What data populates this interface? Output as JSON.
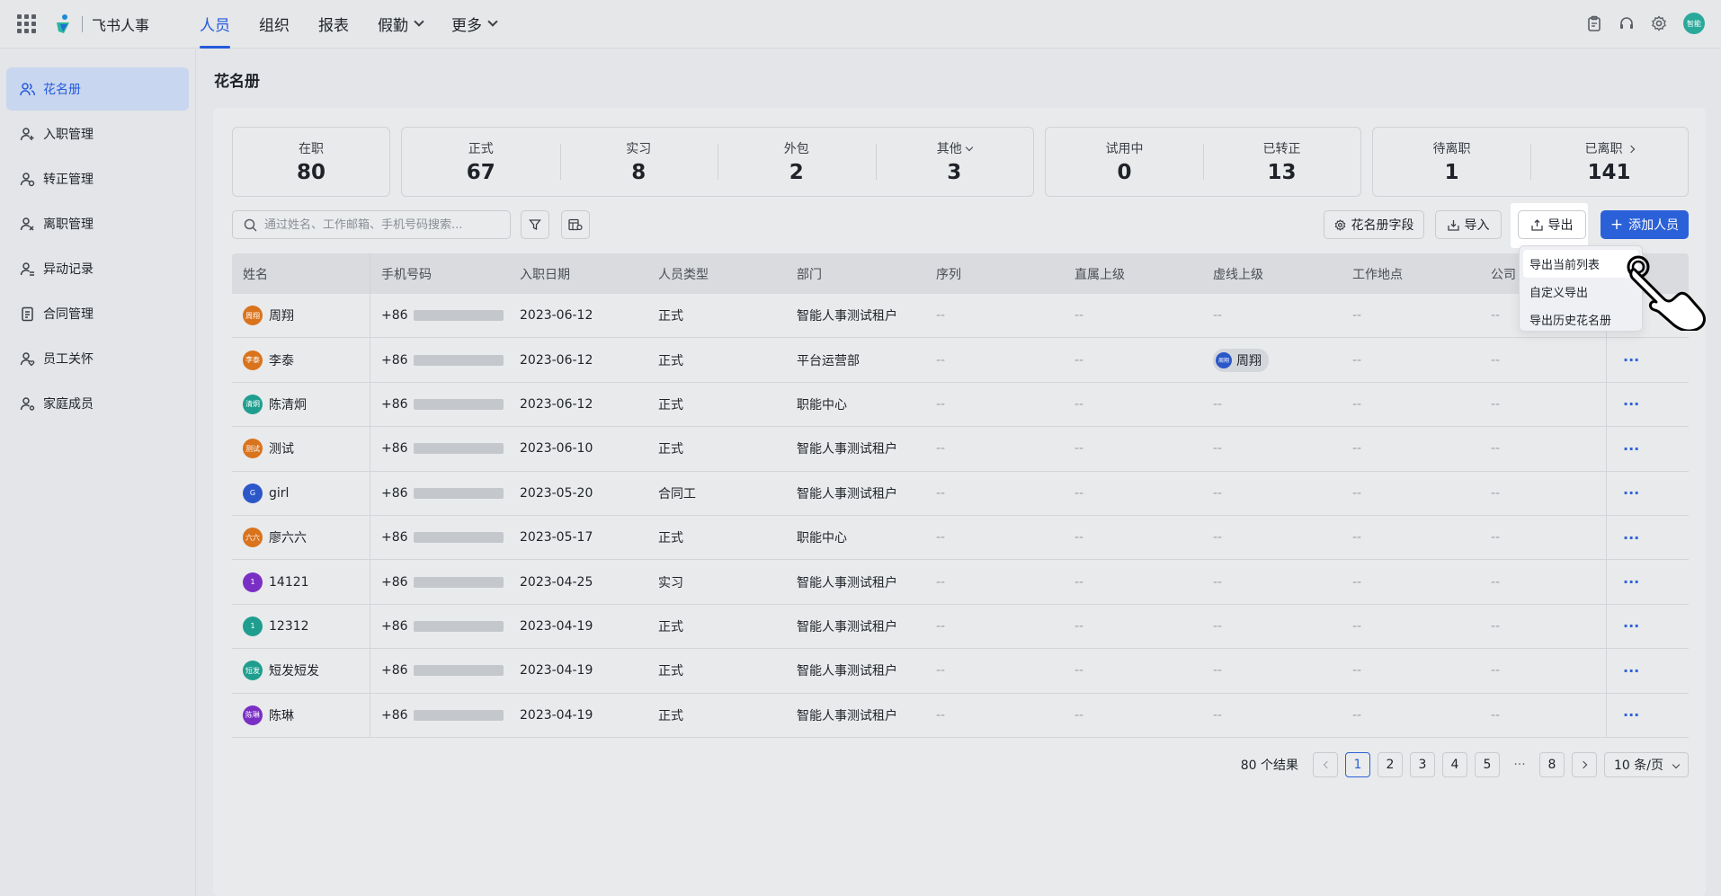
{
  "app": {
    "name": "飞书人事",
    "avatar_text": "智能"
  },
  "nav": [
    {
      "label": "人员",
      "active": true
    },
    {
      "label": "组织"
    },
    {
      "label": "报表"
    },
    {
      "label": "假勤"
    },
    {
      "label": "更多"
    }
  ],
  "sidebar": [
    {
      "label": "花名册",
      "active": true
    },
    {
      "label": "入职管理"
    },
    {
      "label": "转正管理"
    },
    {
      "label": "离职管理"
    },
    {
      "label": "异动记录"
    },
    {
      "label": "合同管理"
    },
    {
      "label": "员工关怀"
    },
    {
      "label": "家庭成员"
    }
  ],
  "page_title": "花名册",
  "stats": {
    "active": {
      "label": "在职",
      "value": "80"
    },
    "formal": {
      "label": "正式",
      "value": "67"
    },
    "intern": {
      "label": "实习",
      "value": "8"
    },
    "outsource": {
      "label": "外包",
      "value": "2"
    },
    "other": {
      "label": "其他",
      "value": "3"
    },
    "probation": {
      "label": "试用中",
      "value": "0"
    },
    "converted": {
      "label": "已转正",
      "value": "13"
    },
    "pending_leave": {
      "label": "待离职",
      "value": "1"
    },
    "left": {
      "label": "已离职",
      "value": "141"
    }
  },
  "toolbar": {
    "search_placeholder": "通过姓名、工作邮箱、手机号码搜索...",
    "fields_label": "花名册字段",
    "import_label": "导入",
    "export_label": "导出",
    "add_label": "添加人员"
  },
  "export_menu": [
    "导出当前列表",
    "自定义导出",
    "导出历史花名册"
  ],
  "table": {
    "headers": [
      "姓名",
      "手机号码",
      "入职日期",
      "人员类型",
      "部门",
      "序列",
      "直属上级",
      "虚线上级",
      "工作地点",
      "公司"
    ],
    "empty": "--",
    "action": "···",
    "phone_prefix": "+86",
    "rows": [
      {
        "avatar": "周翔",
        "avatar_color": "#d9731c",
        "name": "周翔",
        "date": "2023-06-12",
        "type": "正式",
        "dept": "智能人事测试租户"
      },
      {
        "avatar": "李泰",
        "avatar_color": "#d9731c",
        "name": "李泰",
        "date": "2023-06-12",
        "type": "正式",
        "dept": "平台运营部",
        "vmgr": "周翔",
        "vmgr_avatar": "周翔"
      },
      {
        "avatar": "清炯",
        "avatar_color": "#1f9e8f",
        "name": "陈清炯",
        "date": "2023-06-12",
        "type": "正式",
        "dept": "职能中心"
      },
      {
        "avatar": "测试",
        "avatar_color": "#d9731c",
        "name": "测试",
        "date": "2023-06-10",
        "type": "正式",
        "dept": "智能人事测试租户"
      },
      {
        "avatar": "G",
        "avatar_color": "#2b57c9",
        "name": "girl",
        "date": "2023-05-20",
        "type": "合同工",
        "dept": "智能人事测试租户"
      },
      {
        "avatar": "六六",
        "avatar_color": "#d9731c",
        "name": "廖六六",
        "date": "2023-05-17",
        "type": "正式",
        "dept": "职能中心"
      },
      {
        "avatar": "1",
        "avatar_color": "#7a2fc4",
        "name": "14121",
        "date": "2023-04-25",
        "type": "实习",
        "dept": "智能人事测试租户"
      },
      {
        "avatar": "1",
        "avatar_color": "#1f9e8f",
        "name": "12312",
        "date": "2023-04-19",
        "type": "正式",
        "dept": "智能人事测试租户"
      },
      {
        "avatar": "短发",
        "avatar_color": "#1f9e8f",
        "name": "短发短发",
        "date": "2023-04-19",
        "type": "正式",
        "dept": "智能人事测试租户"
      },
      {
        "avatar": "陈琳",
        "avatar_color": "#7a2fc4",
        "name": "陈琳",
        "date": "2023-04-19",
        "type": "正式",
        "dept": "智能人事测试租户"
      }
    ]
  },
  "pagination": {
    "total": "80 个结果",
    "pages": [
      "1",
      "2",
      "3",
      "4",
      "5"
    ],
    "ellipsis": "···",
    "last": "8",
    "page_size": "10 条/页",
    "current": "1"
  }
}
